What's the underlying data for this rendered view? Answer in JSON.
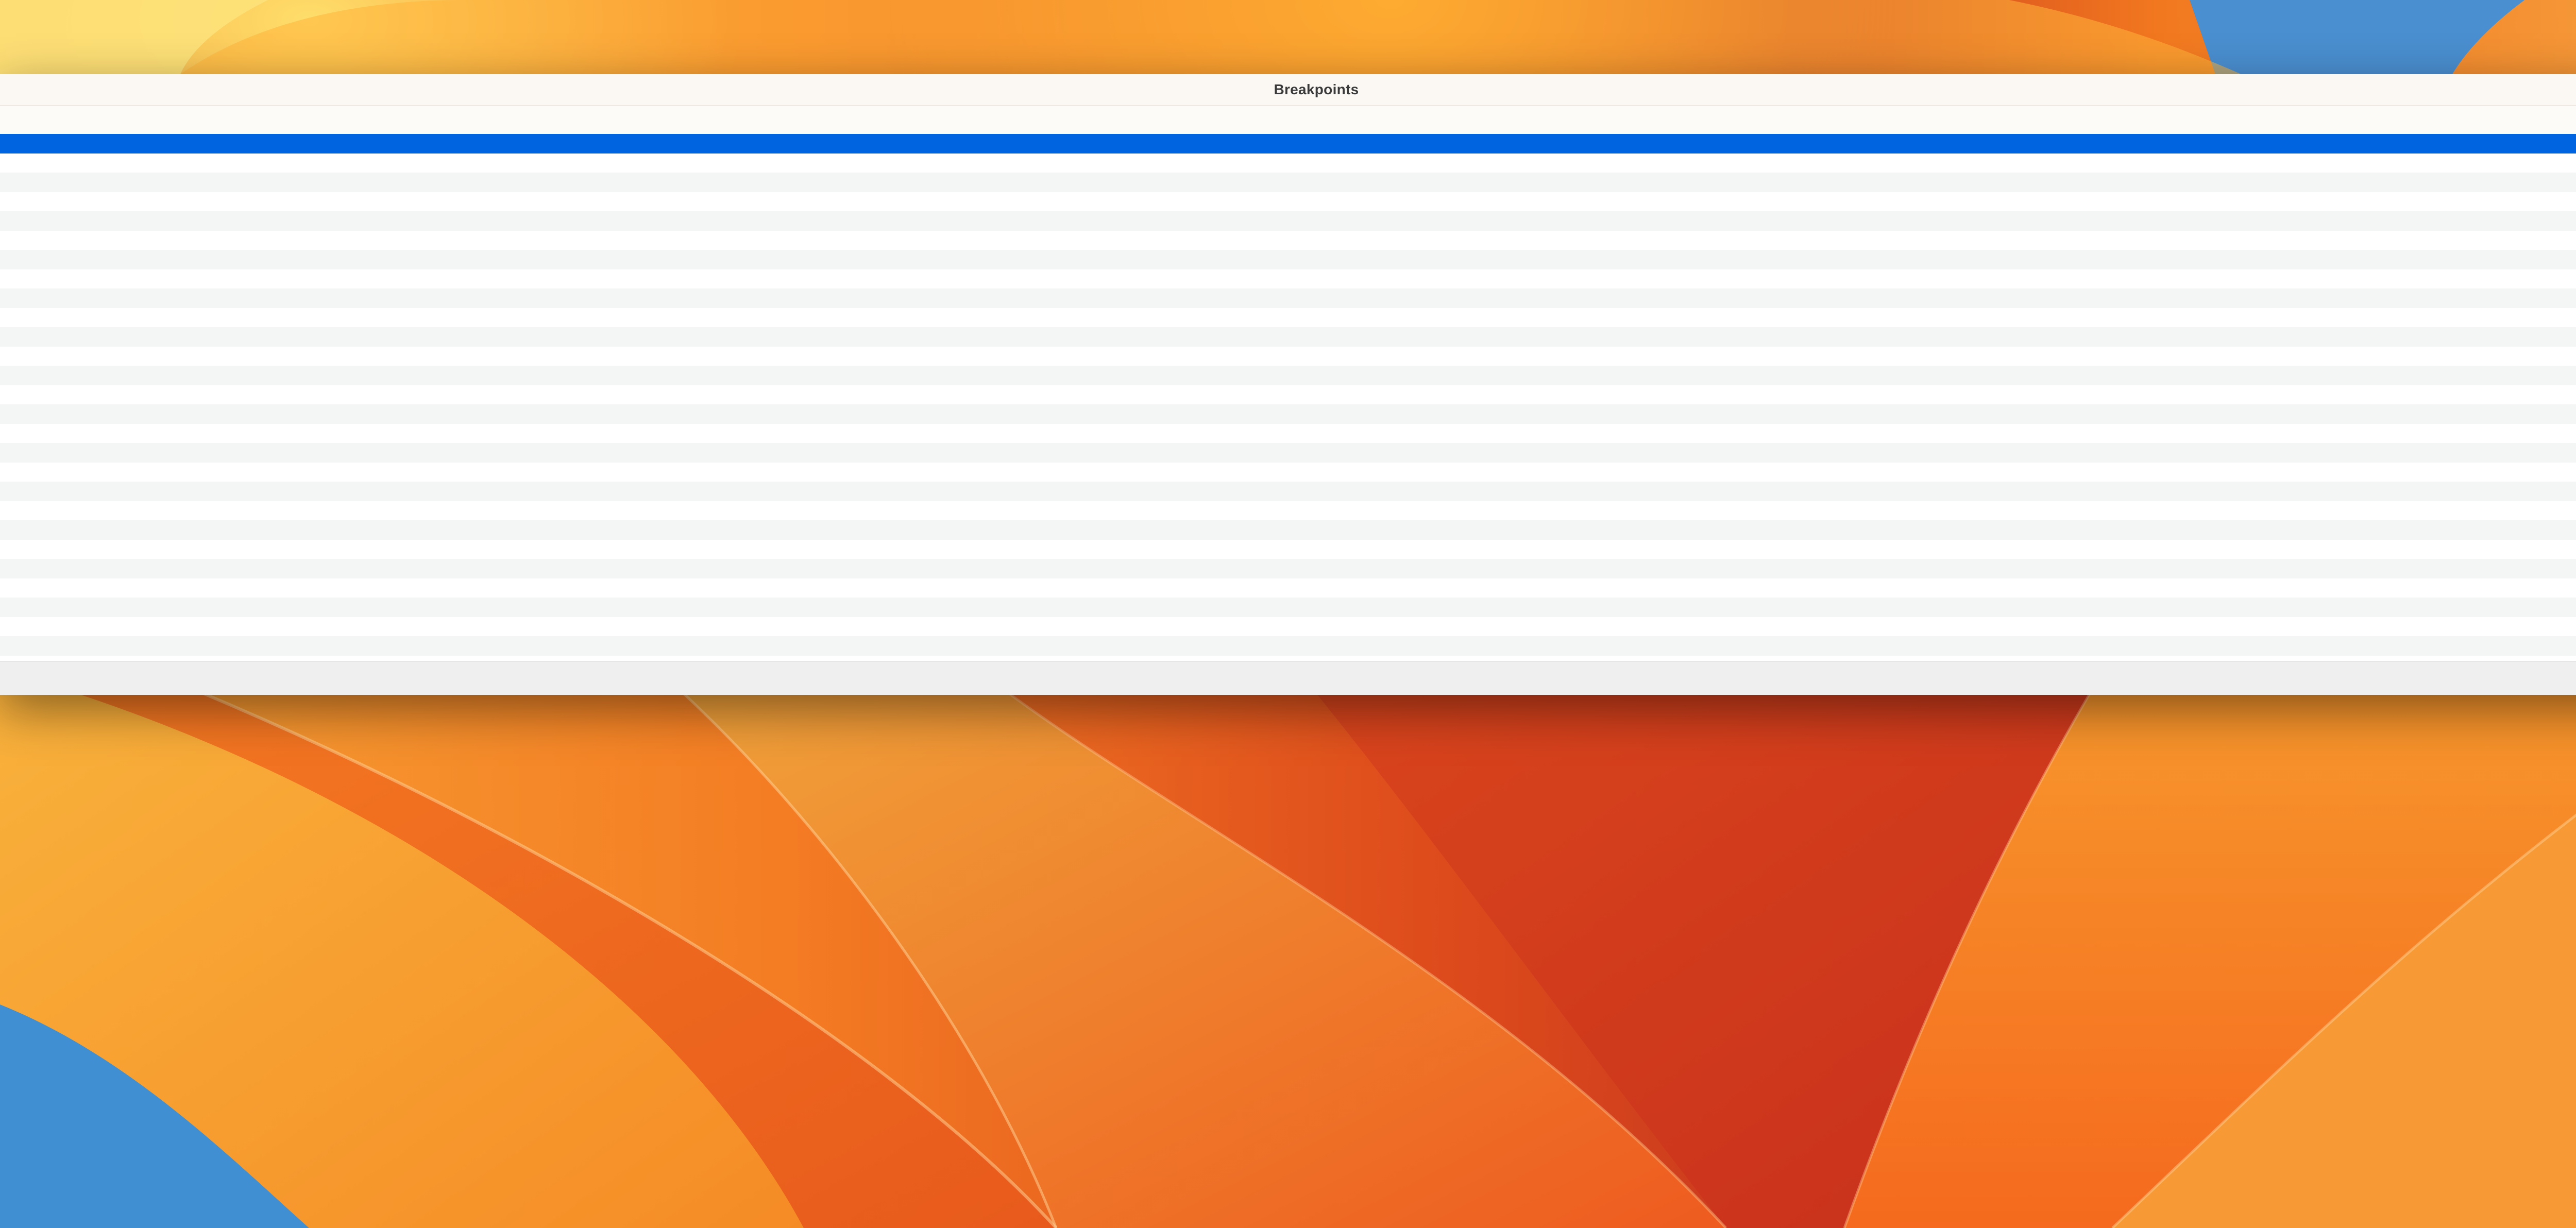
{
  "window": {
    "title": "Breakpoints"
  },
  "list": {
    "row_count": 27,
    "selected_index": 0
  },
  "colors": {
    "selection": "#0064e0",
    "row_alt": "#f4f5f5",
    "row": "#ffffff"
  }
}
